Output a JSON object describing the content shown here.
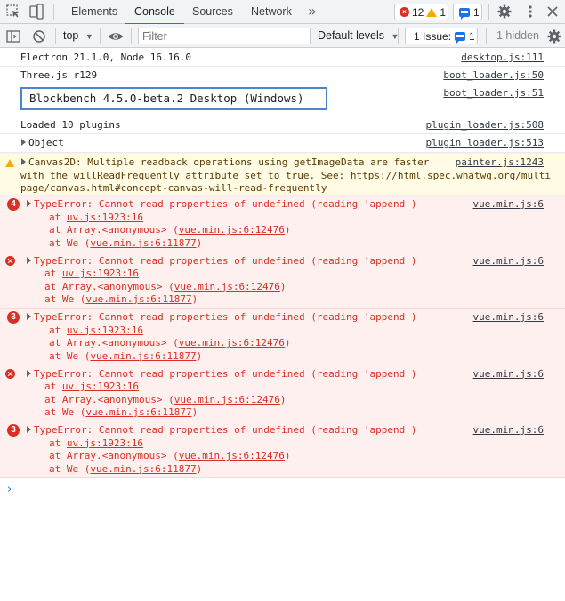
{
  "tabbar": {
    "tabs": [
      "Elements",
      "Console",
      "Sources",
      "Network"
    ],
    "active_tab": "Console",
    "error_count": "12",
    "warning_count": "1",
    "message_count": "1"
  },
  "toolbar": {
    "context": "top",
    "filter_placeholder": "Filter",
    "levels_label": "Default levels",
    "issue_label": "1 Issue:",
    "issue_count": "1",
    "hidden_label": "1 hidden"
  },
  "logs": [
    {
      "text": "Electron 21.1.0, Node 16.16.0",
      "source": "desktop.js:111"
    },
    {
      "text": "Three.js r129",
      "source": "boot_loader.js:50"
    },
    {
      "text": "Blockbench 4.5.0-beta.2 Desktop (Windows)",
      "source": "boot_loader.js:51"
    },
    {
      "text": "Loaded 10 plugins",
      "source": "plugin_loader.js:508"
    },
    {
      "text": "Object",
      "source": "plugin_loader.js:513"
    }
  ],
  "warning": {
    "line1": "Canvas2D: Multiple readback operations using getImageData are faster",
    "line2": "with the willReadFrequently attribute set to true. See: ",
    "link_a": "https://html.spec.whatwg.org/multi",
    "link_b": "page/canvas.html#concept-canvas-will-read-frequently",
    "source": "painter.js:1243"
  },
  "errors": [
    {
      "badge": "4",
      "message": "TypeError: Cannot read properties of undefined (reading 'append')",
      "source": "vue.min.js:6",
      "frame1_link": "uv.js:1923:16",
      "frame2_link": "vue.min.js:6:12476",
      "frame3_link": "vue.min.js:6:11877"
    },
    {
      "badge": "",
      "message": "TypeError: Cannot read properties of undefined (reading 'append')",
      "source": "vue.min.js:6",
      "frame1_link": "uv.js:1923:16",
      "frame2_link": "vue.min.js:6:12476",
      "frame3_link": "vue.min.js:6:11877"
    },
    {
      "badge": "3",
      "message": "TypeError: Cannot read properties of undefined (reading 'append')",
      "source": "vue.min.js:6",
      "frame1_link": "uv.js:1923:16",
      "frame2_link": "vue.min.js:6:12476",
      "frame3_link": "vue.min.js:6:11877"
    },
    {
      "badge": "",
      "message": "TypeError: Cannot read properties of undefined (reading 'append')",
      "source": "vue.min.js:6",
      "frame1_link": "uv.js:1923:16",
      "frame2_link": "vue.min.js:6:12476",
      "frame3_link": "vue.min.js:6:11877"
    },
    {
      "badge": "3",
      "message": "TypeError: Cannot read properties of undefined (reading 'append')",
      "source": "vue.min.js:6",
      "frame1_link": "uv.js:1923:16",
      "frame2_link": "vue.min.js:6:12476",
      "frame3_link": "vue.min.js:6:11877"
    }
  ],
  "frames": {
    "at": "at ",
    "frame1_name": "",
    "frame2_name": "Array.<anonymous> (",
    "frame3_name": "We (",
    "close": ")"
  },
  "colors": {
    "accent": "#1a73e8",
    "error": "#d93025",
    "warning": "#f9ab00"
  }
}
